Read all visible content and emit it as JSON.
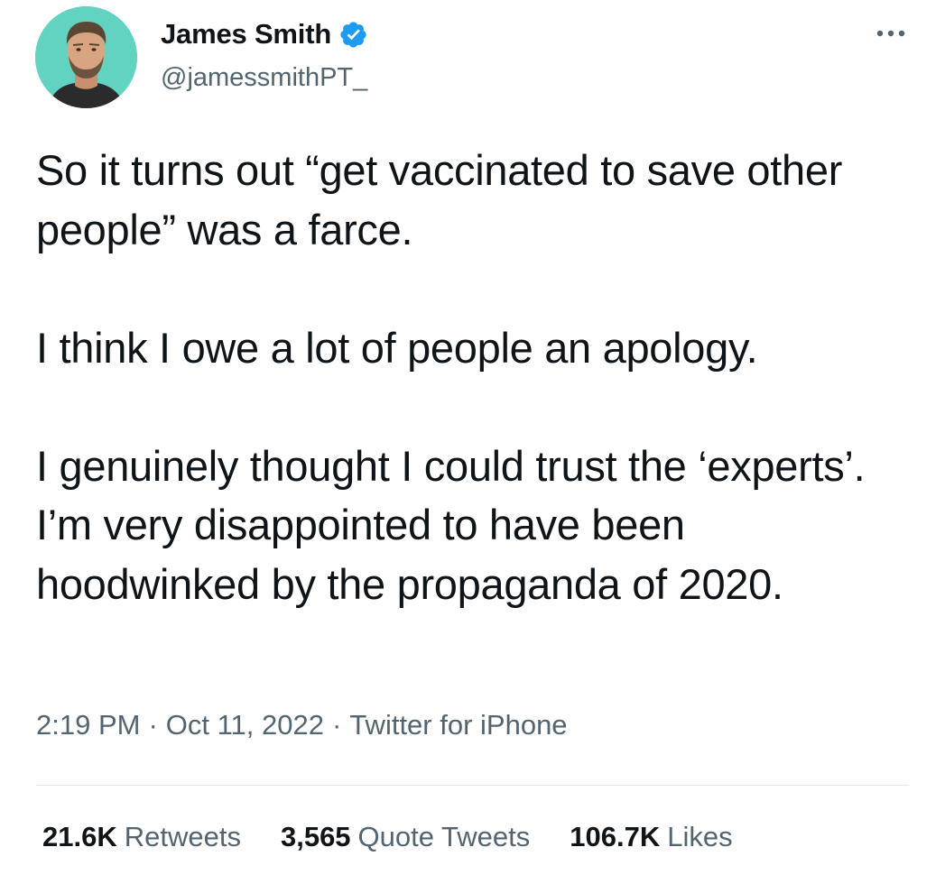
{
  "author": {
    "display_name": "James Smith",
    "handle": "@jamessmithPT_",
    "verified": true,
    "avatar_icon": "profile-photo",
    "verified_icon": "verified-badge-icon",
    "verified_color": "#1d9bf0"
  },
  "more_icon": "more-options-icon",
  "tweet": {
    "paragraphs": [
      "So it turns out “get vaccinated to save other people” was a farce.",
      "I think I owe a lot of people an apology.",
      "I genuinely thought I could trust the ‘experts’. I’m very disappointed to have been hoodwinked by the propaganda of 2020."
    ]
  },
  "meta": {
    "time": "2:19 PM",
    "separator": "·",
    "date": "Oct 11, 2022",
    "source": "Twitter for iPhone"
  },
  "stats": {
    "retweets": {
      "count": "21.6K",
      "label": "Retweets"
    },
    "quote_tweets": {
      "count": "3,565",
      "label": "Quote Tweets"
    },
    "likes": {
      "count": "106.7K",
      "label": "Likes"
    }
  },
  "colors": {
    "text_primary": "#0f1419",
    "text_secondary": "#536471",
    "avatar_background": "#62d3c1",
    "divider": "#e4e8eb"
  }
}
